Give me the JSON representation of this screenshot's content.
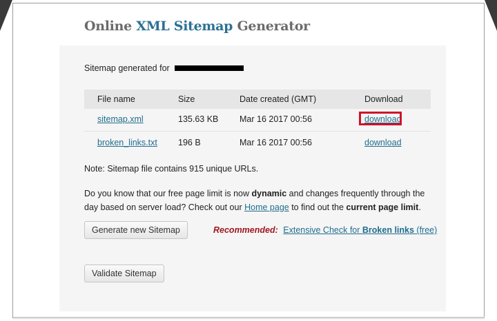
{
  "header": {
    "title_part1": "Online ",
    "title_part2": "XML Sitemap",
    "title_part3": " Generator"
  },
  "summary": {
    "generated_for_label": "Sitemap generated for"
  },
  "table": {
    "columns": [
      "File name",
      "Size",
      "Date created (GMT)",
      "Download"
    ],
    "rows": [
      {
        "file": "sitemap.xml",
        "size": "135.63 KB",
        "date": "Mar 16 2017 00:56",
        "download": "download"
      },
      {
        "file": "broken_links.txt",
        "size": "196 B",
        "date": "Mar 16 2017 00:56",
        "download": "download"
      }
    ]
  },
  "note": "Note: Sitemap file contains 915 unique URLs.",
  "info": {
    "text1": "Do you know that our free page limit is now ",
    "bold1": "dynamic",
    "text2": " and changes frequently through the day based on server load? Check out our ",
    "link": "Home page",
    "text3": " to find out the ",
    "bold2": "current page limit",
    "text4": "."
  },
  "actions": {
    "generate_label": "Generate new Sitemap",
    "recommended_label": "Recommended:",
    "recommended_link_pre": "Extensive Check for ",
    "recommended_link_bold": "Broken links",
    "recommended_link_post": " (free)",
    "validate_label": "Validate Sitemap"
  },
  "colors": {
    "link": "#1f6d8e",
    "title_accent": "#2c7096",
    "highlight": "#d0122a",
    "recommended": "#a01722"
  }
}
